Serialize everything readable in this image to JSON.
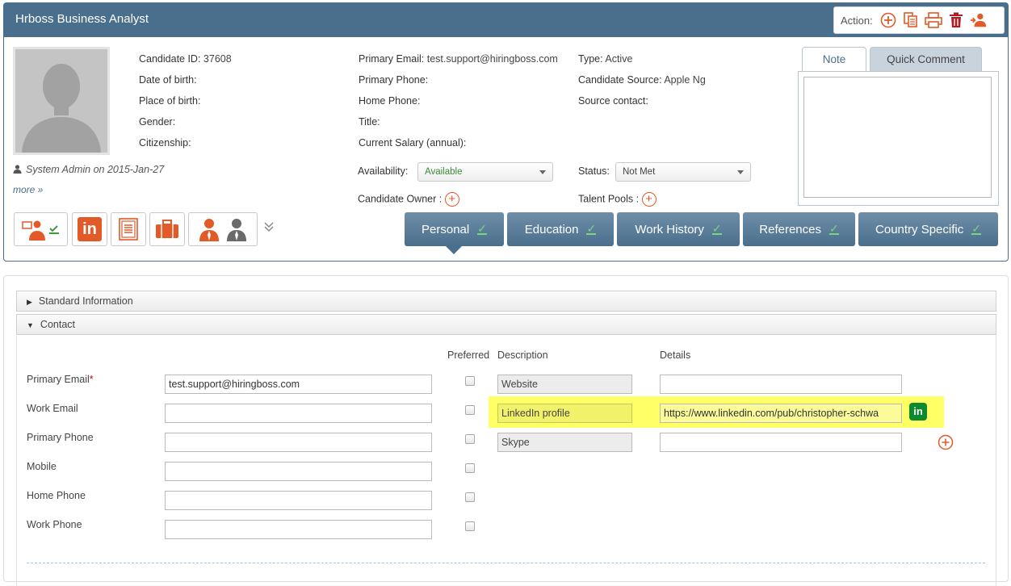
{
  "header": {
    "title": "Hrboss Business Analyst",
    "action_label": "Action:"
  },
  "profile": {
    "byline": "System Admin on 2015-Jan-27",
    "more": "more »",
    "candidate_id_label": "Candidate ID:",
    "candidate_id": "37608",
    "dob_label": "Date of birth:",
    "pob_label": "Place of birth:",
    "gender_label": "Gender:",
    "citizenship_label": "Citizenship:",
    "primary_email_label": "Primary Email:",
    "primary_email": "test.support@hiringboss.com",
    "primary_phone_label": "Primary Phone:",
    "home_phone_label": "Home Phone:",
    "title_label": "Title:",
    "salary_label": "Current Salary (annual):",
    "type_label": "Type:",
    "type": "Active",
    "source_label": "Candidate Source:",
    "source": "Apple Ng",
    "source_contact_label": "Source contact:",
    "availability_label": "Availability:",
    "availability": "Available",
    "status_label": "Status:",
    "status": "Not Met",
    "owner_label": "Candidate Owner :",
    "talent_pools_label": "Talent Pools :"
  },
  "note_tabs": [
    "Note",
    "Quick Comment"
  ],
  "tabs": [
    "Personal",
    "Education",
    "Work History",
    "References",
    "Country Specific"
  ],
  "accordion": {
    "standard": "Standard Information",
    "contact": "Contact"
  },
  "contact": {
    "headers": {
      "preferred": "Preferred",
      "description": "Description",
      "details": "Details"
    },
    "fields": [
      {
        "label": "Primary Email",
        "value": "test.support@hiringboss.com",
        "required": "*"
      },
      {
        "label": "Work Email",
        "value": ""
      },
      {
        "label": "Primary Phone",
        "value": ""
      },
      {
        "label": "Mobile",
        "value": ""
      },
      {
        "label": "Home Phone",
        "value": ""
      },
      {
        "label": "Work Phone",
        "value": ""
      }
    ],
    "extras": [
      {
        "description": "Website",
        "details": ""
      },
      {
        "description": "LinkedIn profile",
        "details": "https://www.linkedin.com/pub/christopher-schwa"
      },
      {
        "description": "Skype",
        "details": ""
      }
    ],
    "linkedin_badge": "in"
  },
  "colors": {
    "header_bg": "#4a6f8c",
    "accent": "#e25a28",
    "check": "#7ed37e",
    "highlight": "#ffff66",
    "linkedin": "#0e8a2e"
  }
}
